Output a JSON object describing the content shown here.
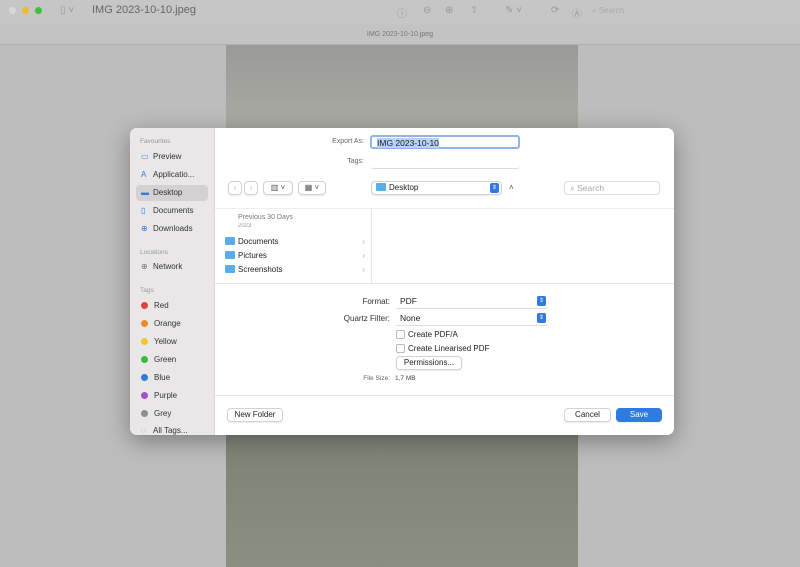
{
  "window": {
    "title": "IMG 2023-10-10.jpeg",
    "doc_title": "IMG 2023-10-10.jpeg",
    "search_placeholder": "Search"
  },
  "sidebar": {
    "favourites_label": "Favourites",
    "favourites": [
      {
        "label": "Preview",
        "icon": "preview-icon"
      },
      {
        "label": "Applicatio...",
        "icon": "applications-icon"
      },
      {
        "label": "Desktop",
        "icon": "desktop-icon",
        "selected": true
      },
      {
        "label": "Documents",
        "icon": "document-icon"
      },
      {
        "label": "Downloads",
        "icon": "download-icon"
      }
    ],
    "locations_label": "Locations",
    "locations": [
      {
        "label": "Network",
        "icon": "globe-icon"
      }
    ],
    "tags_label": "Tags",
    "tags": [
      {
        "label": "Red",
        "color": "#e8403a"
      },
      {
        "label": "Orange",
        "color": "#f08a24"
      },
      {
        "label": "Yellow",
        "color": "#f3c623"
      },
      {
        "label": "Green",
        "color": "#3cb93c"
      },
      {
        "label": "Blue",
        "color": "#2f7be0"
      },
      {
        "label": "Purple",
        "color": "#a450c8"
      },
      {
        "label": "Grey",
        "color": "#8e8e8e"
      },
      {
        "label": "All Tags...",
        "icon": "all-tags-icon"
      }
    ]
  },
  "form": {
    "export_as_label": "Export As:",
    "export_as_value": "IMG 2023-10-10",
    "tags_label": "Tags:",
    "location": "Desktop"
  },
  "browser": {
    "section": "Previous 30 Days",
    "partial": "2023",
    "items": [
      "Documents",
      "Pictures",
      "Screenshots"
    ],
    "search_placeholder": "Search"
  },
  "options": {
    "format_label": "Format:",
    "format_value": "PDF",
    "filter_label": "Quartz Filter:",
    "filter_value": "None",
    "pdfa": "Create PDF/A",
    "linearised": "Create Linearised PDF",
    "permissions": "Permissions...",
    "filesize_label": "File Size:",
    "filesize_value": "1,7 MB"
  },
  "buttons": {
    "new_folder": "New Folder",
    "cancel": "Cancel",
    "save": "Save"
  },
  "colors": {
    "accent": "#2f7be0"
  }
}
